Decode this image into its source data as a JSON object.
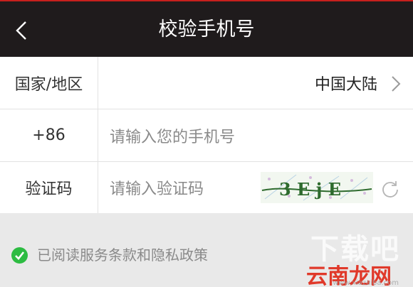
{
  "header": {
    "title": "校验手机号",
    "back_icon": "chevron-left-icon"
  },
  "region": {
    "label": "国家/地区",
    "value": "中国大陆",
    "chevron_icon": "chevron-right-icon"
  },
  "phone": {
    "prefix": "+86",
    "placeholder": "请输入您的手机号",
    "value": ""
  },
  "code": {
    "label": "验证码",
    "placeholder": "请输入验证码",
    "value": "",
    "captcha_text": "3 E j E",
    "refresh_icon": "refresh-icon"
  },
  "agreement": {
    "text": "已阅读服务条款和隐私政策",
    "checked": true
  },
  "watermark": {
    "line1": "下载吧",
    "line2": "云南龙网",
    "line3": "www.xiazaiba.com"
  },
  "colors": {
    "header_bg": "#1f1b1c",
    "accent_red": "#c7201d",
    "check_green": "#2dbc42"
  }
}
